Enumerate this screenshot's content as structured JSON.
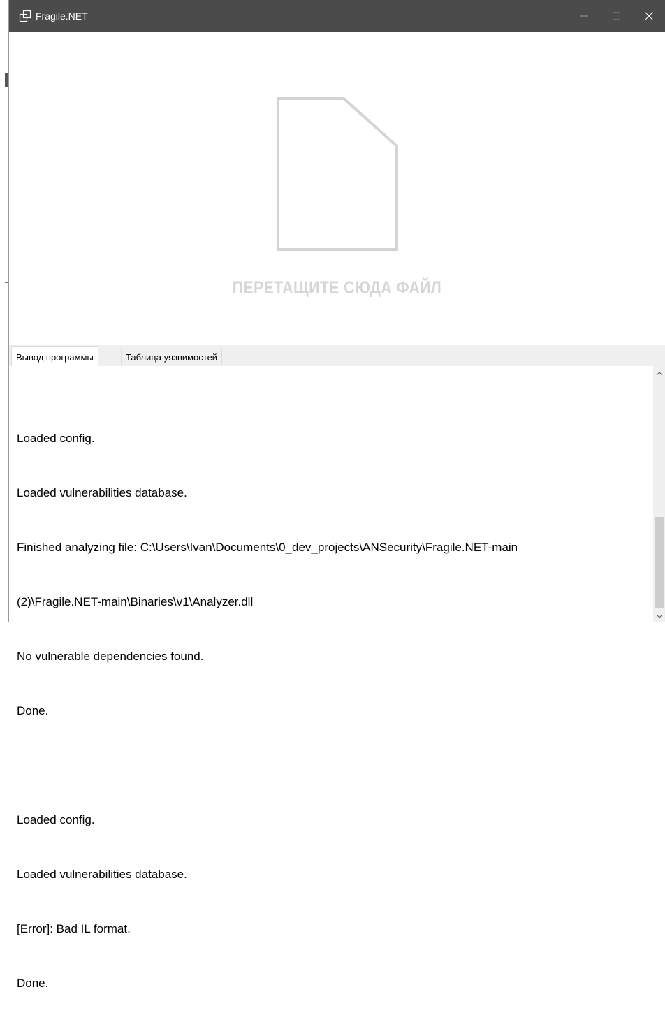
{
  "window": {
    "title": "Fragile.NET",
    "icon": "app-window-icon",
    "controls": [
      "minimize-icon",
      "maximize-icon",
      "close-icon"
    ]
  },
  "drop_zone": {
    "icon": "document-icon",
    "text": "ПЕРЕТАЩИТЕ СЮДА ФАЙЛ"
  },
  "tabs": [
    {
      "label": "Вывод программы",
      "active": true
    },
    {
      "label": "Таблица уязвимостей",
      "active": false
    }
  ],
  "output": {
    "lines": [
      "Loaded config.",
      "Loaded vulnerabilities database.",
      "Finished analyzing file: C:\\Users\\Ivan\\Documents\\0_dev_projects\\ANSecurity\\Fragile.NET-main",
      "(2)\\Fragile.NET-main\\Binaries\\v1\\Analyzer.dll",
      "No vulnerable dependencies found.",
      "Done.",
      "",
      "Loaded config.",
      "Loaded vulnerabilities database.",
      "[Error]: Bad IL format.",
      "Done."
    ]
  },
  "colors": {
    "titlebar": "#4b4b4b",
    "drop_text": "#d6d6d6",
    "tab_bar": "#f0f0f0",
    "scroll_thumb": "#cdcdcd"
  }
}
